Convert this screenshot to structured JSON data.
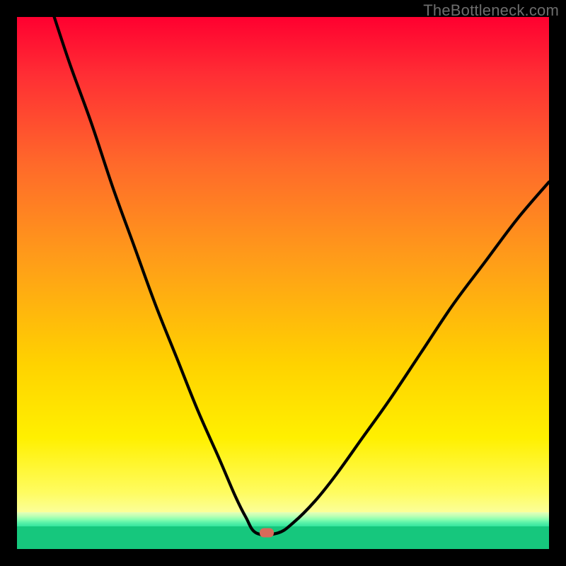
{
  "attribution": "TheBottleneck.com",
  "colors": {
    "frame": "#000000",
    "green_band": "#16c77d",
    "marker": "#d96a5a",
    "curve": "#000000"
  },
  "chart_data": {
    "type": "line",
    "title": "",
    "xlabel": "",
    "ylabel": "",
    "xlim": [
      0,
      100
    ],
    "ylim": [
      0,
      100
    ],
    "grid": false,
    "legend": false,
    "marker": {
      "x": 47,
      "y": 3
    },
    "series": [
      {
        "name": "left-curve",
        "x": [
          7,
          10,
          14,
          18,
          22,
          26,
          30,
          34,
          38,
          41,
          43,
          45
        ],
        "y": [
          100,
          91,
          80,
          68,
          57,
          46,
          36,
          26,
          17,
          10,
          6,
          3
        ]
      },
      {
        "name": "flat",
        "x": [
          45,
          49
        ],
        "y": [
          3,
          3
        ]
      },
      {
        "name": "right-curve",
        "x": [
          49,
          52,
          56,
          60,
          65,
          70,
          76,
          82,
          88,
          94,
          100
        ],
        "y": [
          3,
          5,
          9,
          14,
          21,
          28,
          37,
          46,
          54,
          62,
          69
        ]
      }
    ]
  }
}
